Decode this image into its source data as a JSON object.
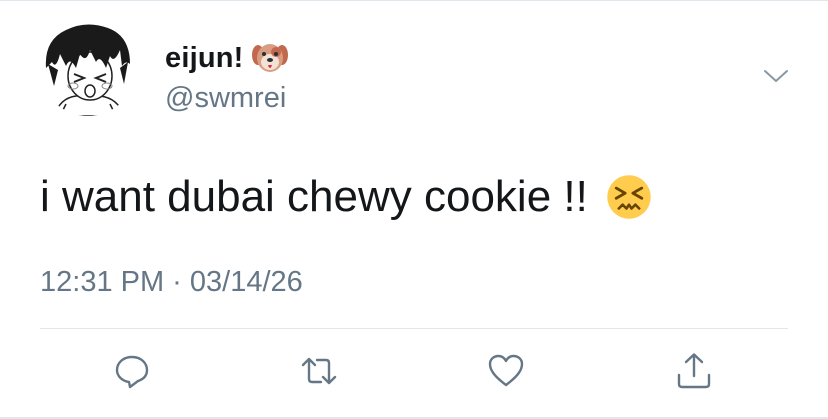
{
  "tweet": {
    "display_name": "eijun!",
    "name_emoji": "dog-face-emoji",
    "handle": "@swmrei",
    "text": "i want dubai chewy cookie !!",
    "text_emoji": "confounded-face-emoji",
    "timestamp": "12:31 PM · 03/14/26"
  },
  "icons": {
    "more": "chevron-down-icon",
    "reply": "reply-icon",
    "retweet": "retweet-icon",
    "like": "heart-icon",
    "share": "share-icon"
  },
  "colors": {
    "text_primary": "#14171a",
    "text_secondary": "#657786",
    "border": "#e1e8ed",
    "icon": "#657786",
    "emoji_yellow": "#FFCC4D"
  }
}
